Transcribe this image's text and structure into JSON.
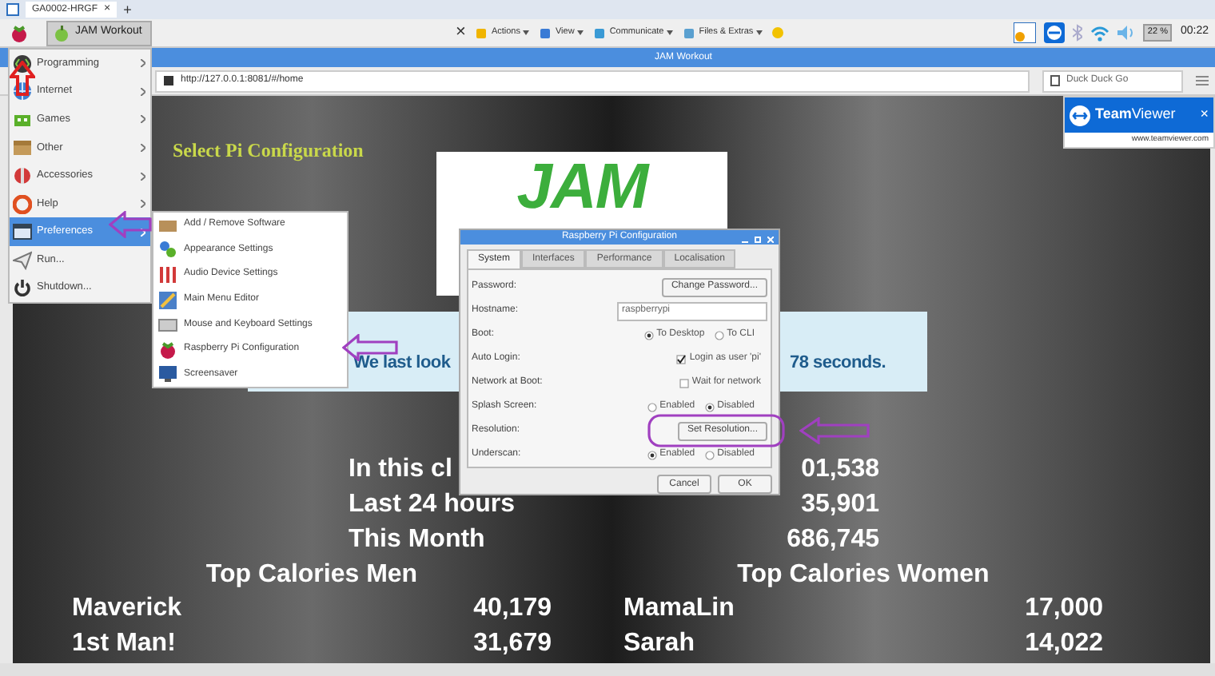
{
  "remote_tab": {
    "label": "GA0002-HRGF",
    "close": "×",
    "add": "+"
  },
  "taskbar": {
    "window_button": "JAM Workout"
  },
  "remote_toolbar": {
    "close": "×",
    "menus": [
      "Actions",
      "View",
      "Communicate",
      "Files & Extras"
    ]
  },
  "tray": {
    "battery": "22 %",
    "clock": "00:22"
  },
  "browser": {
    "title": "JAM Workout",
    "url": "http://127.0.0.1:8081/#/home",
    "search_placeholder": "Duck Duck Go"
  },
  "app_menu": [
    {
      "label": "Programming",
      "submenu": true,
      "selected": false
    },
    {
      "label": "Internet",
      "submenu": true,
      "selected": false
    },
    {
      "label": "Games",
      "submenu": true,
      "selected": false
    },
    {
      "label": "Other",
      "submenu": true,
      "selected": false
    },
    {
      "label": "Accessories",
      "submenu": true,
      "selected": false
    },
    {
      "label": "Help",
      "submenu": true,
      "selected": false
    },
    {
      "label": "Preferences",
      "submenu": true,
      "selected": true
    },
    {
      "label": "Run...",
      "submenu": false,
      "selected": false
    },
    {
      "label": "Shutdown...",
      "submenu": false,
      "selected": false
    }
  ],
  "preferences_menu": [
    "Add / Remove Software",
    "Appearance Settings",
    "Audio Device Settings",
    "Main Menu Editor",
    "Mouse and Keyboard Settings",
    "Raspberry Pi Configuration",
    "Screensaver"
  ],
  "page": {
    "heading": "Select Pi Configuration",
    "logo": "JAM",
    "banner": {
      "left": "We last look",
      "right": "78 seconds."
    },
    "stats": [
      {
        "label": "In this cl",
        "value": "01,538"
      },
      {
        "label": "Last 24 hours",
        "value": "35,901"
      },
      {
        "label": "This Month",
        "value": "686,745"
      }
    ],
    "leaderboards": [
      {
        "title": "Top Calories Men",
        "rows": [
          {
            "name": "Maverick",
            "calories": "40,179"
          },
          {
            "name": "1st Man!",
            "calories": "31,679"
          }
        ]
      },
      {
        "title": "Top Calories Women",
        "rows": [
          {
            "name": "MamaLin",
            "calories": "17,000"
          },
          {
            "name": "Sarah",
            "calories": "14,022"
          }
        ]
      }
    ]
  },
  "dialog": {
    "title": "Raspberry Pi Configuration",
    "tabs": [
      {
        "label": "System",
        "selected": true
      },
      {
        "label": "Interfaces",
        "selected": false
      },
      {
        "label": "Performance",
        "selected": false
      },
      {
        "label": "Localisation",
        "selected": false
      }
    ],
    "rows": [
      {
        "kind": "button",
        "label": "Password:",
        "button": "Change Password..."
      },
      {
        "kind": "text",
        "label": "Hostname:",
        "value": "raspberrypi"
      },
      {
        "kind": "radio",
        "label": "Boot:",
        "options": [
          {
            "label": "To Desktop",
            "selected": true
          },
          {
            "label": "To CLI",
            "selected": false
          }
        ]
      },
      {
        "kind": "check",
        "label": "Auto Login:",
        "option": "Login as user 'pi'",
        "checked": true
      },
      {
        "kind": "check",
        "label": "Network at Boot:",
        "option": "Wait for network",
        "checked": false
      },
      {
        "kind": "radio",
        "label": "Splash Screen:",
        "options": [
          {
            "label": "Enabled",
            "selected": false
          },
          {
            "label": "Disabled",
            "selected": true
          }
        ]
      },
      {
        "kind": "button",
        "label": "Resolution:",
        "button": "Set Resolution..."
      },
      {
        "kind": "radio",
        "label": "Underscan:",
        "options": [
          {
            "label": "Enabled",
            "selected": true
          },
          {
            "label": "Disabled",
            "selected": false
          }
        ]
      }
    ],
    "buttons": [
      "Cancel",
      "OK"
    ]
  },
  "teamviewer": {
    "brand": "**Team**Viewer",
    "close": "×",
    "url": "www.teamviewer.com"
  }
}
